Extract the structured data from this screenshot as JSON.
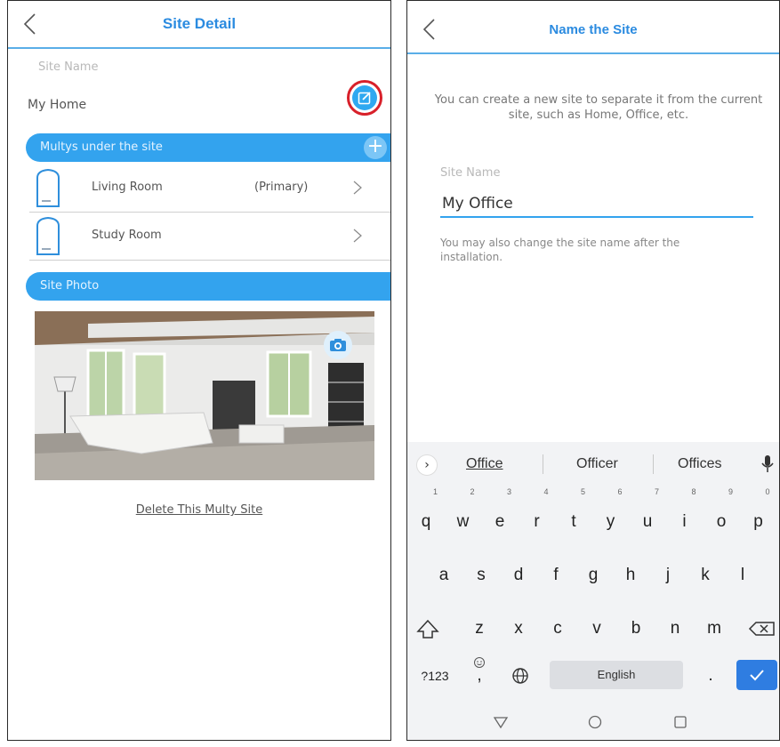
{
  "left": {
    "header": {
      "title": "Site Detail"
    },
    "site_name": {
      "label": "Site Name",
      "value": "My Home"
    },
    "multys_section": {
      "title": "Multys under the site",
      "add_label": "+"
    },
    "devices": [
      {
        "name": "Living Room",
        "tag": "(Primary)"
      },
      {
        "name": "Study Room",
        "tag": ""
      }
    ],
    "photo_section": {
      "title": "Site Photo"
    },
    "delete_link": "Delete This Multy Site"
  },
  "right": {
    "header": {
      "title": "Name the Site"
    },
    "info_text": "You can create a new site to separate it from the current site, such as Home, Office, etc.",
    "field_label": "Site Name",
    "field_value": "My Office",
    "hint_text": "You may also change the site name after the installation.",
    "keyboard": {
      "suggestions": [
        "Office",
        "Officer",
        "Offices"
      ],
      "row1": [
        {
          "k": "q",
          "n": "1"
        },
        {
          "k": "w",
          "n": "2"
        },
        {
          "k": "e",
          "n": "3"
        },
        {
          "k": "r",
          "n": "4"
        },
        {
          "k": "t",
          "n": "5"
        },
        {
          "k": "y",
          "n": "6"
        },
        {
          "k": "u",
          "n": "7"
        },
        {
          "k": "i",
          "n": "8"
        },
        {
          "k": "o",
          "n": "9"
        },
        {
          "k": "p",
          "n": "0"
        }
      ],
      "row2": [
        "a",
        "s",
        "d",
        "f",
        "g",
        "h",
        "j",
        "k",
        "l"
      ],
      "row3": [
        "z",
        "x",
        "c",
        "v",
        "b",
        "n",
        "m"
      ],
      "symbols_label": "?123",
      "comma_label": ",",
      "space_label": "English",
      "period_label": "."
    }
  },
  "colors": {
    "accent": "#2b8be0",
    "bar": "#33a3ee",
    "highlight": "#d8202a",
    "enter": "#2f7de1"
  },
  "icons": [
    "back-icon",
    "edit-icon",
    "plus-icon",
    "multy-device-icon",
    "chevron-right-icon",
    "camera-icon",
    "mic-icon",
    "shift-icon",
    "backspace-icon",
    "globe-icon",
    "emoji-icon",
    "check-icon",
    "nav-back-icon",
    "nav-home-icon",
    "nav-recents-icon"
  ]
}
